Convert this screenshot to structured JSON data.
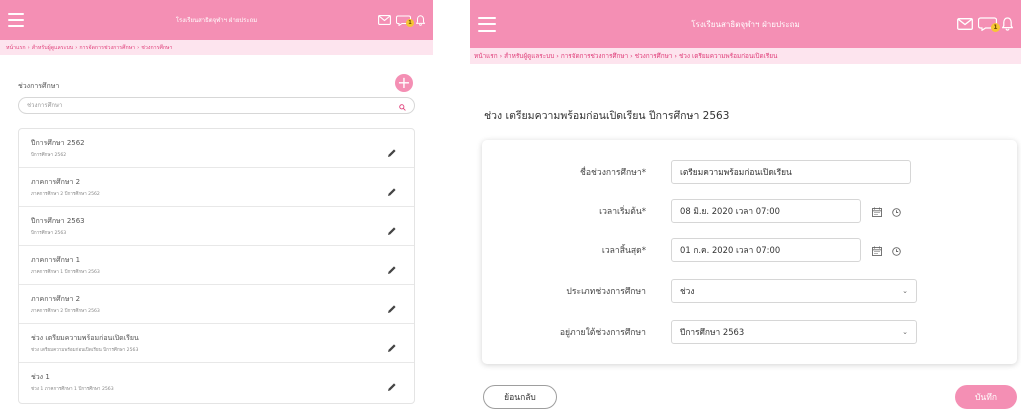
{
  "left": {
    "header": {
      "school_name": "โรงเรียนสาธิตจุฬาฯ ฝ่ายประถม",
      "notification_count": "1"
    },
    "breadcrumb": [
      "หน้าแรก",
      "สำหรับผู้ดูแลระบบ",
      "การจัดการช่วงการศึกษา",
      "ช่วงการศึกษา"
    ],
    "list_title": "ช่วงการศึกษา",
    "search": {
      "placeholder": "ช่วงการศึกษา"
    },
    "items": [
      {
        "title": "ปีการศึกษา 2562",
        "subtitle": "ปีการศึกษา 2562"
      },
      {
        "title": "ภาคการศึกษา 2",
        "subtitle": "ภาคการศึกษา 2 ปีการศึกษา 2562"
      },
      {
        "title": "ปีการศึกษา 2563",
        "subtitle": "ปีการศึกษา 2563"
      },
      {
        "title": "ภาคการศึกษา 1",
        "subtitle": "ภาคการศึกษา 1 ปีการศึกษา 2563"
      },
      {
        "title": "ภาคการศึกษา 2",
        "subtitle": "ภาคการศึกษา 2 ปีการศึกษา 2563"
      },
      {
        "title": "ช่วง เตรียมความพร้อมก่อนเปิดเรียน",
        "subtitle": "ช่วง เตรียมความพร้อมก่อนเปิดเรียน ปีการศึกษา 2563"
      },
      {
        "title": "ช่วง 1",
        "subtitle": "ช่วง 1 ภาคการศึกษา 1 ปีการศึกษา 2563"
      }
    ]
  },
  "right": {
    "header": {
      "school_name": "โรงเรียนสาธิตจุฬาฯ ฝ่ายประถม",
      "notification_count": "1"
    },
    "breadcrumb": [
      "หน้าแรก",
      "สำหรับผู้ดูแลระบบ",
      "การจัดการช่วงการศึกษา",
      "ช่วงการศึกษา",
      "ช่วง เตรียมความพร้อมก่อนเปิดเรียน"
    ],
    "page_title": "ช่วง เตรียมความพร้อมก่อนเปิดเรียน ปีการศึกษา 2563",
    "form": {
      "name_label": "ชื่อช่วงการศึกษา*",
      "name_value": "เตรียมความพร้อมก่อนเปิดเรียน",
      "start_label": "เวลาเริ่มต้น*",
      "start_value": "08 มิ.ย. 2020 เวลา 07:00",
      "end_label": "เวลาสิ้นสุด*",
      "end_value": "01 ก.ค. 2020 เวลา 07:00",
      "type_label": "ประเภทช่วงการศึกษา",
      "type_value": "ช่วง",
      "parent_label": "อยู่ภายใต้ช่วงการศึกษา",
      "parent_value": "ปีการศึกษา 2563"
    },
    "buttons": {
      "back": "ย้อนกลับ",
      "save": "บันทึก"
    }
  },
  "colors": {
    "brand_pink": "#f48fb4",
    "breadcrumb_bg": "#fde4ee",
    "breadcrumb_text": "#e0407b",
    "badge": "#f6c634"
  },
  "icons": [
    "menu-icon",
    "mail-icon",
    "chat-icon",
    "bell-icon",
    "plus-icon",
    "search-icon",
    "pencil-icon",
    "calendar-icon",
    "clock-icon",
    "chevron-down-icon"
  ]
}
